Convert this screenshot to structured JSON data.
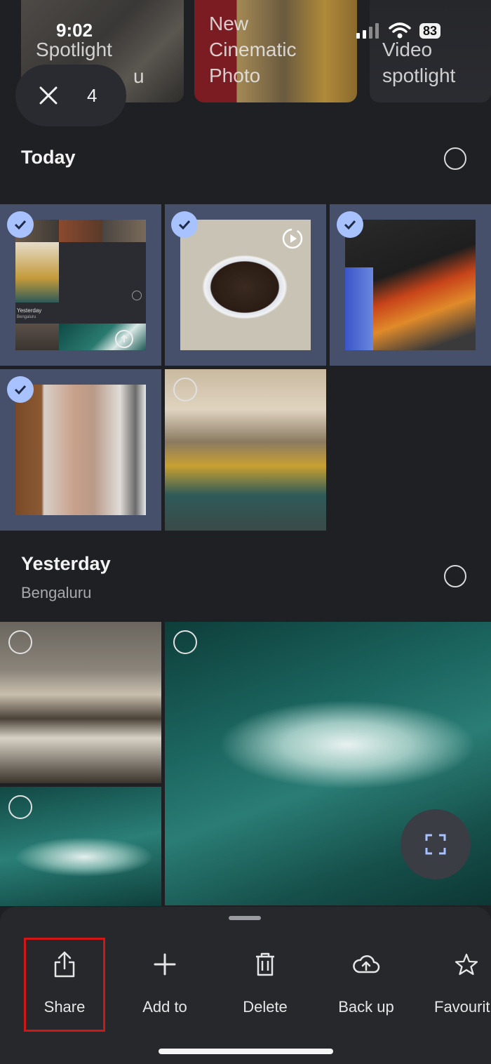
{
  "status_bar": {
    "time": "9:02",
    "battery": "83"
  },
  "memories": [
    {
      "lines": [
        "Spotlight"
      ],
      "extra": "u"
    },
    {
      "lines": [
        "New",
        "Cinematic",
        "Photo"
      ]
    },
    {
      "lines": [
        "Video",
        "spotlight"
      ]
    }
  ],
  "selection": {
    "count": "4",
    "close_icon": "close-icon"
  },
  "sections": {
    "today": {
      "title": "Today"
    },
    "yesterday": {
      "title": "Yesterday",
      "subtitle": "Bengaluru"
    }
  },
  "mini_tile": {
    "title": "Yesterday",
    "subtitle": "Bengaluru"
  },
  "actions": [
    {
      "label": "Share",
      "icon": "share-icon"
    },
    {
      "label": "Add to",
      "icon": "plus-icon"
    },
    {
      "label": "Delete",
      "icon": "trash-icon"
    },
    {
      "label": "Back up",
      "icon": "cloud-upload-icon"
    },
    {
      "label": "Favourit",
      "icon": "star-icon"
    }
  ],
  "colors": {
    "accent_check": "#a7c2ff",
    "highlight": "#d01616",
    "selected_bg": "#46506a"
  }
}
